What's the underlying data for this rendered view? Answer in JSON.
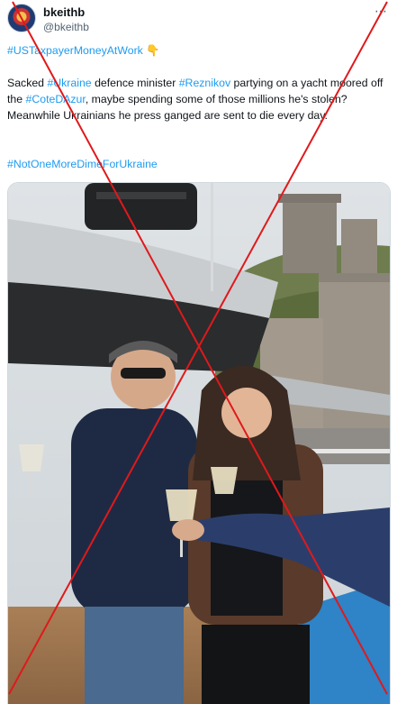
{
  "author": {
    "name": "bkeithb",
    "handle": "@bkeithb"
  },
  "more_icon": "⋯",
  "tweet": {
    "line1_hashtag": "#USTaxpayerMoneyAtWork",
    "line1_emoji": "👇",
    "body": {
      "t1": "Sacked ",
      "h1": "#Ukraine",
      "t2": " defence minister ",
      "h2": "#Reznikov",
      "t3": " partying on a yacht moored off the ",
      "h3": "#CoteDAzur",
      "t4": ", maybe spending some of those millions he's stolen? Meanwhile Ukrainians he press ganged are sent to die every day."
    },
    "line3_hashtag": "#NotOneMoreDimeForUkraine"
  },
  "colors": {
    "link": "#1d9bf0",
    "overlay_x": "#e0191b",
    "muted": "#536471"
  },
  "icons": {
    "avatar": "avatar-emblem-icon",
    "more": "more-options-icon",
    "pointing": "point-down-emoji"
  }
}
